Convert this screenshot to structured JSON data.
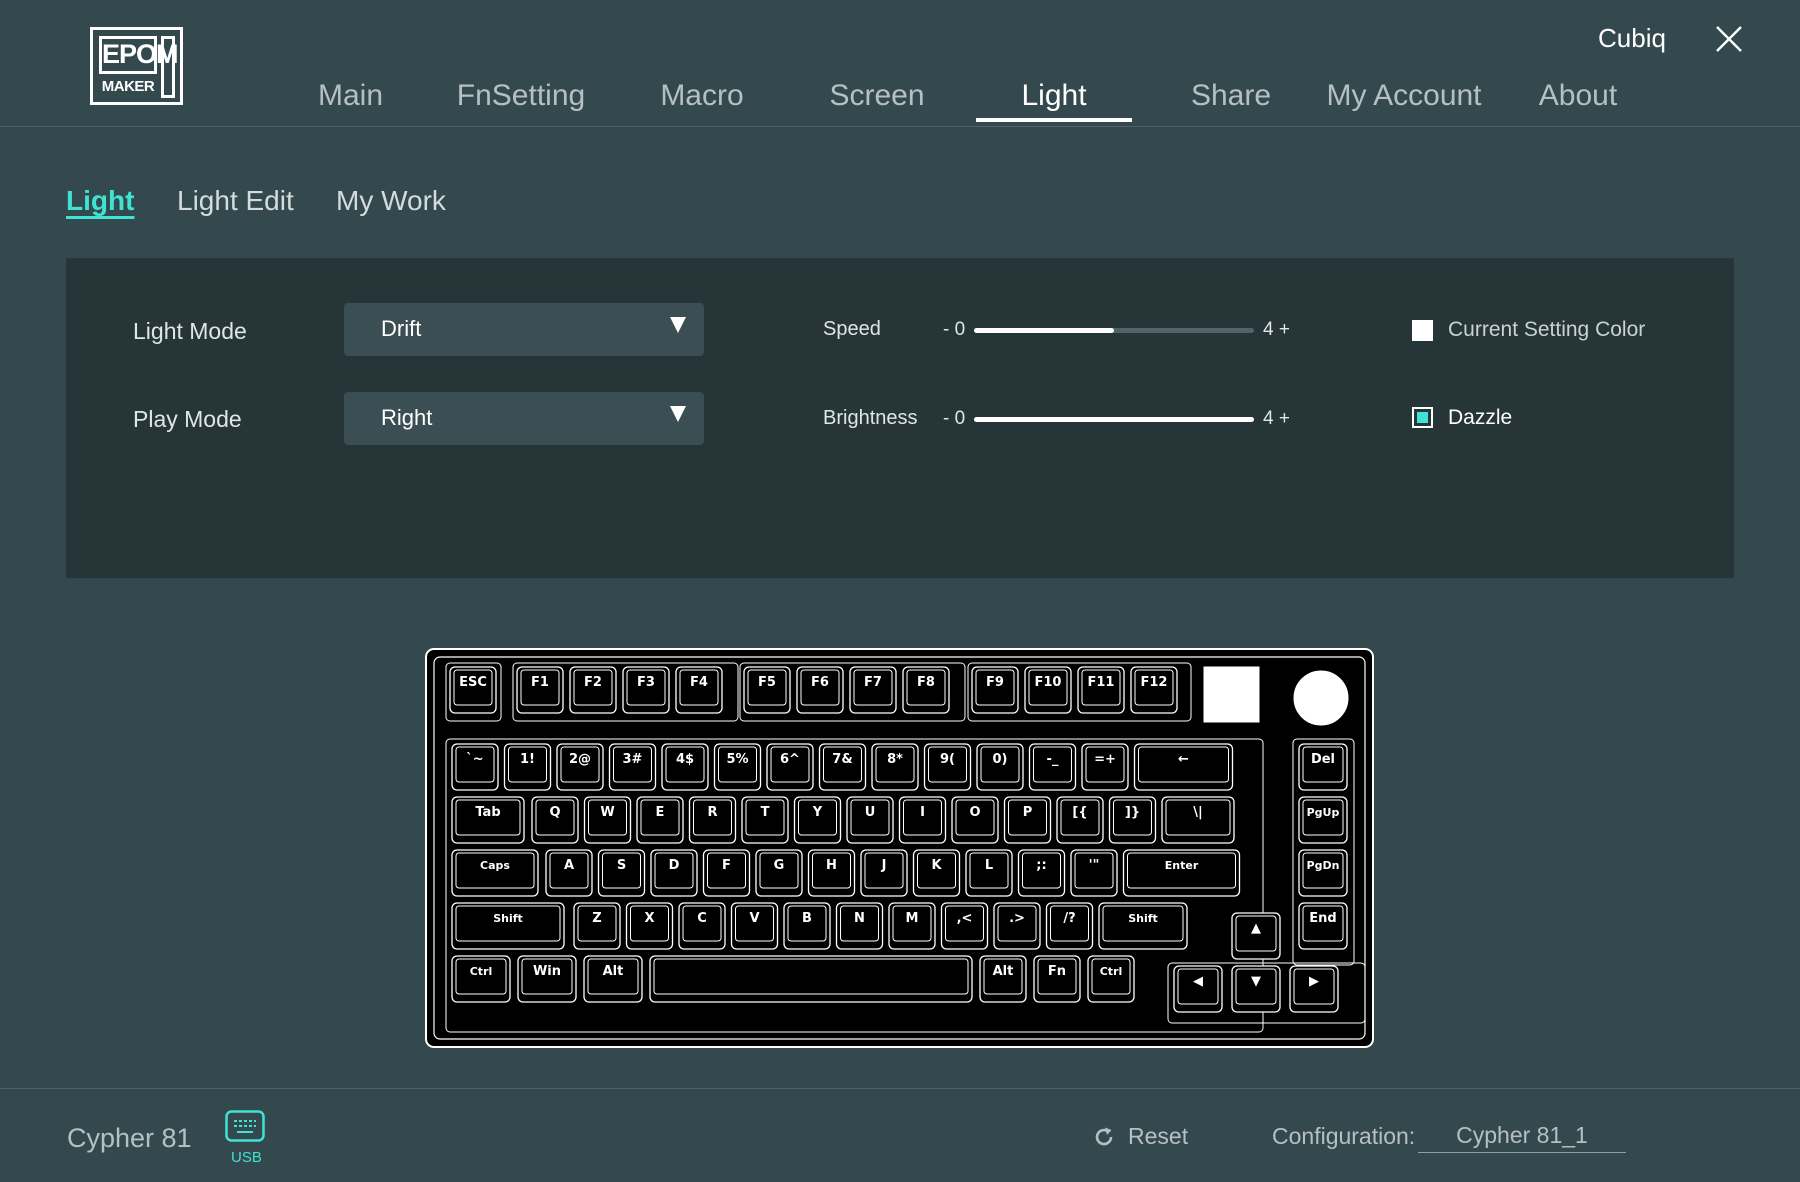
{
  "header": {
    "logo_top": "EPOM",
    "logo_bottom": "MAKER",
    "user_name": "Cubiq",
    "nav_tabs": [
      "Main",
      "FnSetting",
      "Macro",
      "Screen",
      "Light",
      "Share",
      "My Account",
      "About"
    ],
    "active_tab": "Light"
  },
  "subtabs": {
    "items": [
      "Light",
      "Light Edit",
      "My Work"
    ],
    "active": "Light"
  },
  "light_panel": {
    "light_mode_label": "Light Mode",
    "light_mode_value": "Drift",
    "play_mode_label": "Play Mode",
    "play_mode_value": "Right",
    "speed": {
      "label": "Speed",
      "min_text": "- 0",
      "max_text": "4 +",
      "value": 2,
      "max": 4
    },
    "brightness": {
      "label": "Brightness",
      "min_text": "- 0",
      "max_text": "4 +",
      "value": 4,
      "max": 4
    },
    "current_setting_color": {
      "label": "Current Setting Color",
      "checked": false
    },
    "dazzle": {
      "label": "Dazzle",
      "checked": true
    }
  },
  "keyboard": {
    "rows": [
      [
        "ESC",
        "F1",
        "F2",
        "F3",
        "F4",
        "F5",
        "F6",
        "F7",
        "F8",
        "F9",
        "F10",
        "F11",
        "F12"
      ],
      [
        "`~",
        "1!",
        "2@",
        "3#",
        "4$",
        "5%",
        "6^",
        "7&",
        "8*",
        "9(",
        "0)",
        "-_",
        "=+",
        "←",
        "Del"
      ],
      [
        "Tab",
        "Q",
        "W",
        "E",
        "R",
        "T",
        "Y",
        "U",
        "I",
        "O",
        "P",
        "[{",
        "]}",
        "\\|",
        "PgUp"
      ],
      [
        "Caps",
        "A",
        "S",
        "D",
        "F",
        "G",
        "H",
        "J",
        "K",
        "L",
        ";:",
        "'\"",
        "Enter",
        "PgDn"
      ],
      [
        "Shift",
        "Z",
        "X",
        "C",
        "V",
        "B",
        "N",
        "M",
        ",<",
        ".>",
        "/?",
        "Shift",
        "▲",
        "End"
      ],
      [
        "Ctrl",
        "Win",
        "Alt",
        "",
        "Alt",
        "Fn",
        "Ctrl",
        "◀",
        "▼",
        "▶"
      ]
    ]
  },
  "footer": {
    "device_name": "Cypher 81",
    "connection": "USB",
    "reset_label": "Reset",
    "config_label": "Configuration:",
    "config_value": "Cypher 81_1"
  },
  "colors": {
    "accent": "#3fe3d4",
    "background": "#34494e",
    "panel": "#263538",
    "dropdown": "#3b4e53"
  }
}
